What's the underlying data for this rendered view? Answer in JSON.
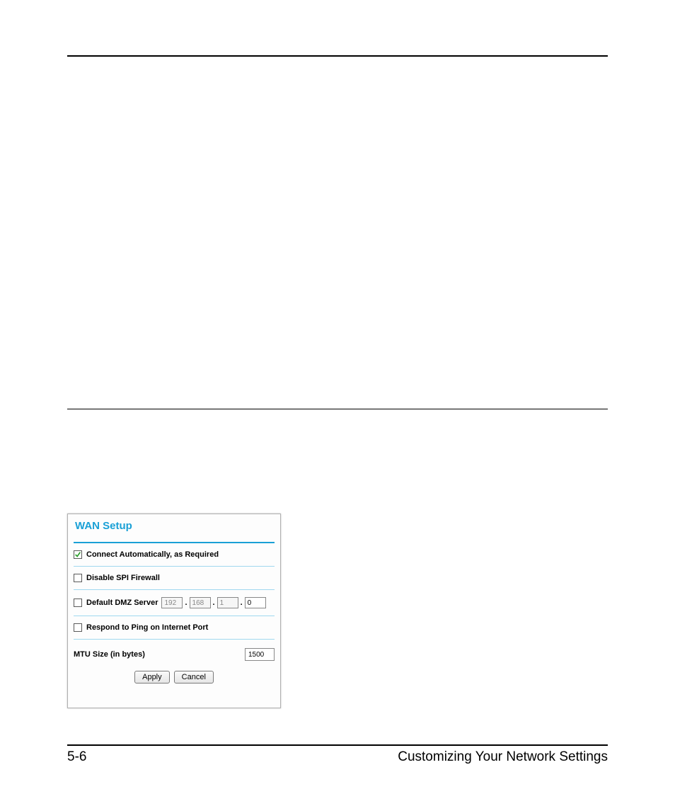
{
  "footer": {
    "page_number": "5-6",
    "section_title": "Customizing Your Network Settings"
  },
  "panel": {
    "title": "WAN Setup",
    "connect_auto": {
      "label": "Connect Automatically, as Required",
      "checked": true
    },
    "disable_spi": {
      "label": "Disable SPI Firewall",
      "checked": false
    },
    "dmz": {
      "label": "Default DMZ Server",
      "checked": false,
      "ip": {
        "o1": "192",
        "o2": "168",
        "o3": "1",
        "o4": "0"
      }
    },
    "respond_ping": {
      "label": "Respond to Ping on Internet Port",
      "checked": false
    },
    "mtu": {
      "label_bold": "MTU Size",
      "label_light": " (in bytes)",
      "value": "1500"
    },
    "buttons": {
      "apply": "Apply",
      "cancel": "Cancel"
    }
  }
}
